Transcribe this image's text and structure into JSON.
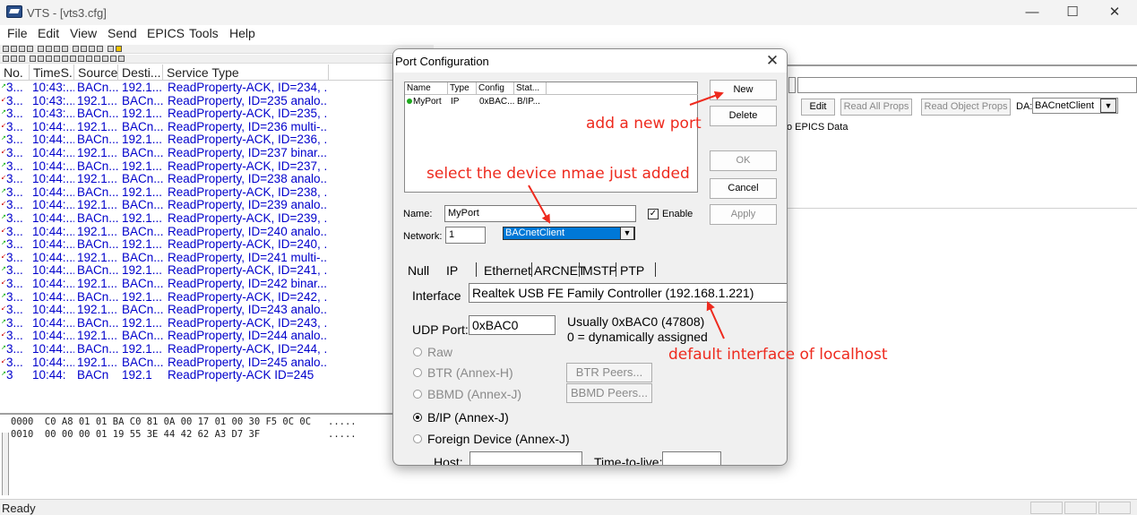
{
  "window": {
    "title": "VTS - [vts3.cfg]",
    "min_glyph": "—",
    "max_glyph": "☐",
    "close_glyph": "✕"
  },
  "menu": [
    "File",
    "Edit",
    "View",
    "Send",
    "EPICS",
    "Tools",
    "Help"
  ],
  "list": {
    "headers": [
      "No.",
      "TimeS...",
      "Source",
      "Desti...",
      "Service Type"
    ],
    "rows": [
      {
        "dir": "out",
        "no": "3...",
        "time": "10:43:...",
        "src": "BACn...",
        "dst": "192.1...",
        "svc": "ReadProperty-ACK, ID=234, ..."
      },
      {
        "dir": "in",
        "no": "3...",
        "time": "10:43:...",
        "src": "192.1...",
        "dst": "BACn...",
        "svc": "ReadProperty, ID=235 analo..."
      },
      {
        "dir": "out",
        "no": "3...",
        "time": "10:43:...",
        "src": "BACn...",
        "dst": "192.1...",
        "svc": "ReadProperty-ACK, ID=235, ..."
      },
      {
        "dir": "in",
        "no": "3...",
        "time": "10:44:...",
        "src": "192.1...",
        "dst": "BACn...",
        "svc": "ReadProperty, ID=236 multi-..."
      },
      {
        "dir": "out",
        "no": "3...",
        "time": "10:44:...",
        "src": "BACn...",
        "dst": "192.1...",
        "svc": "ReadProperty-ACK, ID=236, ..."
      },
      {
        "dir": "in",
        "no": "3...",
        "time": "10:44:...",
        "src": "192.1...",
        "dst": "BACn...",
        "svc": "ReadProperty, ID=237 binar..."
      },
      {
        "dir": "out",
        "no": "3...",
        "time": "10:44:...",
        "src": "BACn...",
        "dst": "192.1...",
        "svc": "ReadProperty-ACK, ID=237, ..."
      },
      {
        "dir": "in",
        "no": "3...",
        "time": "10:44:...",
        "src": "192.1...",
        "dst": "BACn...",
        "svc": "ReadProperty, ID=238 analo..."
      },
      {
        "dir": "out",
        "no": "3...",
        "time": "10:44:...",
        "src": "BACn...",
        "dst": "192.1...",
        "svc": "ReadProperty-ACK, ID=238, ..."
      },
      {
        "dir": "in",
        "no": "3...",
        "time": "10:44:...",
        "src": "192.1...",
        "dst": "BACn...",
        "svc": "ReadProperty, ID=239 analo..."
      },
      {
        "dir": "out",
        "no": "3...",
        "time": "10:44:...",
        "src": "BACn...",
        "dst": "192.1...",
        "svc": "ReadProperty-ACK, ID=239, ..."
      },
      {
        "dir": "in",
        "no": "3...",
        "time": "10:44:...",
        "src": "192.1...",
        "dst": "BACn...",
        "svc": "ReadProperty, ID=240 analo..."
      },
      {
        "dir": "out",
        "no": "3...",
        "time": "10:44:...",
        "src": "BACn...",
        "dst": "192.1...",
        "svc": "ReadProperty-ACK, ID=240, ..."
      },
      {
        "dir": "in",
        "no": "3...",
        "time": "10:44:...",
        "src": "192.1...",
        "dst": "BACn...",
        "svc": "ReadProperty, ID=241 multi-..."
      },
      {
        "dir": "out",
        "no": "3...",
        "time": "10:44:...",
        "src": "BACn...",
        "dst": "192.1...",
        "svc": "ReadProperty-ACK, ID=241, ..."
      },
      {
        "dir": "in",
        "no": "3...",
        "time": "10:44:...",
        "src": "192.1...",
        "dst": "BACn...",
        "svc": "ReadProperty, ID=242 binar..."
      },
      {
        "dir": "out",
        "no": "3...",
        "time": "10:44:...",
        "src": "BACn...",
        "dst": "192.1...",
        "svc": "ReadProperty-ACK, ID=242, ..."
      },
      {
        "dir": "in",
        "no": "3...",
        "time": "10:44:...",
        "src": "192.1...",
        "dst": "BACn...",
        "svc": "ReadProperty, ID=243 analo..."
      },
      {
        "dir": "out",
        "no": "3...",
        "time": "10:44:...",
        "src": "BACn...",
        "dst": "192.1...",
        "svc": "ReadProperty-ACK, ID=243, ..."
      },
      {
        "dir": "in",
        "no": "3...",
        "time": "10:44:...",
        "src": "192.1...",
        "dst": "BACn...",
        "svc": "ReadProperty, ID=244 analo..."
      },
      {
        "dir": "out",
        "no": "3...",
        "time": "10:44:...",
        "src": "BACn...",
        "dst": "192.1...",
        "svc": "ReadProperty-ACK, ID=244, ..."
      },
      {
        "dir": "in",
        "no": "3...",
        "time": "10:44:...",
        "src": "192.1...",
        "dst": "BACn...",
        "svc": "ReadProperty, ID=245 analo..."
      },
      {
        "dir": "out",
        "no": "3",
        "time": "10:44:",
        "src": "BACn",
        "dst": "192.1",
        "svc": "ReadProperty-ACK  ID=245"
      }
    ]
  },
  "hex": {
    "line1": "0000  C0 A8 01 01 BA C0 81 0A 00 17 01 00 30 F5 0C 0C   .....",
    "line2": "0010  00 00 00 01 19 55 3E 44 42 62 A3 D7 3F            ....."
  },
  "right_panel": {
    "edit_label": "Edit",
    "read_all_label": "Read All Props",
    "read_object_label": "Read Object Props",
    "da_label": "DA:",
    "da_value": "BACnetClient",
    "epics_text": "o EPICS Data"
  },
  "status": {
    "text": "Ready"
  },
  "dialog": {
    "title": "Port Configuration",
    "close_glyph": "✕",
    "port_list": {
      "headers": [
        "Name",
        "Type",
        "Config",
        "Stat..."
      ],
      "row": {
        "name": "MyPort",
        "type": "IP",
        "config": "0xBAC...",
        "status": "B/IP..."
      }
    },
    "buttons": {
      "new": "New",
      "delete": "Delete",
      "ok": "OK",
      "cancel": "Cancel",
      "apply": "Apply"
    },
    "name_label": "Name:",
    "name_value": "MyPort",
    "enable_label": "Enable",
    "enable_checked": true,
    "network_label": "Network:",
    "network_value": "1",
    "network_combo": "BACnetClient",
    "tabs": [
      "Null",
      "IP",
      "Ethernet",
      "ARCNET",
      "MSTP",
      "PTP"
    ],
    "active_tab": "IP",
    "interface_label": "Interface",
    "interface_value": "Realtek USB FE Family Controller (192.168.1.221)",
    "udp_label": "UDP Port:",
    "udp_value": "0xBAC0",
    "udp_hint1": "Usually 0xBAC0 (47808)",
    "udp_hint2": "0 = dynamically assigned",
    "modes": {
      "raw": "Raw",
      "btr": "BTR (Annex-H)",
      "bbmd": "BBMD (Annex-J)",
      "bip": "B/IP (Annex-J)",
      "foreign": "Foreign Device (Annex-J)"
    },
    "selected_mode": "bip",
    "btr_peers_label": "BTR Peers...",
    "bbmd_peers_label": "BBMD Peers...",
    "host_label": "Host:",
    "ttl_label": "Time-to-live:"
  },
  "annotations": {
    "new_port": "add a new port",
    "select_device": "select the device nmae just added",
    "default_iface": "default interface of localhost",
    "color": "#ee2a1e"
  },
  "colors": {
    "list_text": "#0000cc",
    "dir_out": "#00aa00",
    "dir_in": "#cc0000",
    "combo_highlight": "#0078d7"
  }
}
